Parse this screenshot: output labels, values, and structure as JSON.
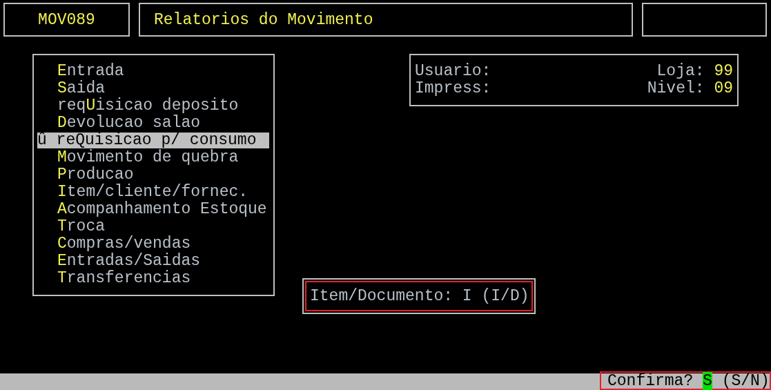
{
  "header": {
    "code": "MOV089",
    "title": "Relatorios do Movimento"
  },
  "menu": [
    {
      "key": "E",
      "post": "ntrada",
      "selected": false
    },
    {
      "key": "S",
      "post": "aida",
      "selected": false
    },
    {
      "pre": "req",
      "key": "U",
      "post": "isicao deposito",
      "selected": false
    },
    {
      "key": "D",
      "post": "evolucao salao",
      "selected": false
    },
    {
      "marker": "û",
      "pre": "re",
      "key": "Q",
      "post": "uisicao p/ consumo",
      "selected": true
    },
    {
      "key": "M",
      "post": "ovimento de quebra",
      "selected": false
    },
    {
      "key": "P",
      "post": "roducao",
      "selected": false
    },
    {
      "key": "I",
      "post": "tem/cliente/fornec.",
      "selected": false
    },
    {
      "key": "A",
      "post": "companhamento Estoque",
      "selected": false
    },
    {
      "key": "T",
      "post": "roca",
      "selected": false
    },
    {
      "key": "C",
      "post": "ompras/vendas",
      "selected": false
    },
    {
      "key": "E",
      "post": "ntradas/Saidas",
      "selected": false
    },
    {
      "key": "T",
      "post": "ransferencias",
      "selected": false
    }
  ],
  "info": {
    "rows": [
      {
        "label": "Usuario:",
        "right_label": "Loja:",
        "right_value": "99"
      },
      {
        "label": "Impress:",
        "right_label": "Nivel:",
        "right_value": "09"
      }
    ]
  },
  "prompt": {
    "label": "Item/Documento:",
    "value": "I",
    "options": "(I/D)"
  },
  "status_bar": {
    "label": "Confirma?",
    "value": "S",
    "options": "(S/N)"
  }
}
